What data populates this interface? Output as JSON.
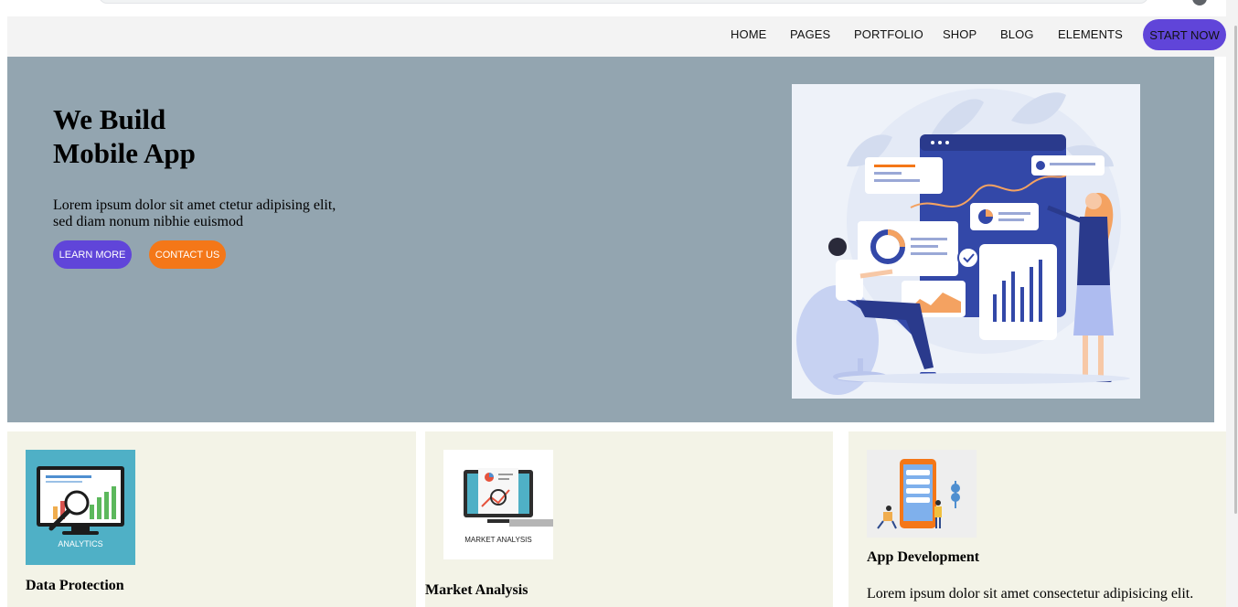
{
  "nav": {
    "items": [
      "HOME",
      "PAGES",
      "PORTFOLIO",
      "SHOP",
      "BLOG",
      "ELEMENTS"
    ],
    "cta": "START NOW"
  },
  "hero": {
    "title_line1": "We Build",
    "title_line2": "Mobile App",
    "text_line1": "Lorem ipsum dolor sit amet ctetur adipising elit,",
    "text_line2": "sed diam nonum nibhie euismod",
    "learn_more": "LEARN MORE",
    "contact_us": "CONTACT US",
    "illustration": "analytics-dashboard-illustration"
  },
  "cards": [
    {
      "image_caption": "ANALYTICS",
      "title": "Data Protection"
    },
    {
      "image_caption": "MARKET ANALYSIS",
      "title": "Market Analysis"
    },
    {
      "title": "App Development",
      "text": "Lorem ipsum dolor sit amet consectetur adipisicing elit."
    }
  ],
  "colors": {
    "accent_purple": "#6045d9",
    "accent_orange": "#f47718",
    "hero_bg": "#93a5b0",
    "card_bg": "#f3f3e7",
    "nav_bg": "#f3f3f3"
  }
}
